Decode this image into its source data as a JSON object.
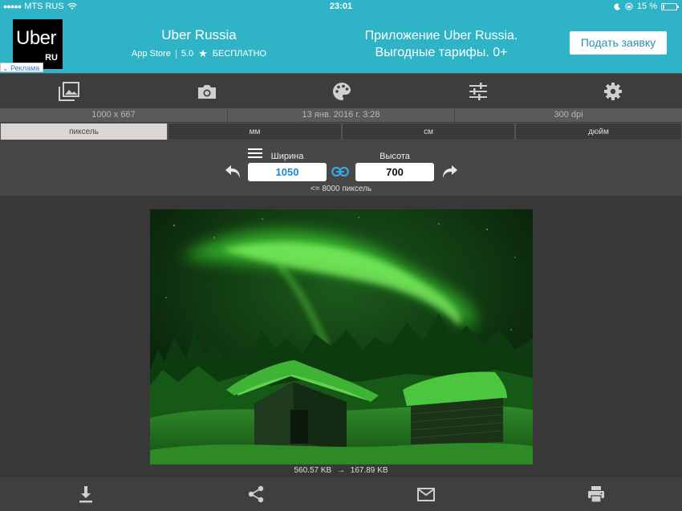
{
  "status": {
    "carrier": "MTS RUS",
    "time": "23:01",
    "battery": "15 %",
    "battery_level": 0.15
  },
  "ad": {
    "logo_text": "Uber",
    "logo_sub": "RU",
    "tag": "Реклама",
    "title": "Uber Russia",
    "store": "App Store",
    "rating": "5.0",
    "price": "БЕСПЛАТНО",
    "desc_line1": "Приложение Uber Russia.",
    "desc_line2": "Выгодные тарифы. 0+",
    "button": "Подать заявку"
  },
  "toolbar": {
    "icons": [
      "gallery-icon",
      "camera-icon",
      "palette-icon",
      "sliders-icon",
      "gear-icon"
    ]
  },
  "info": {
    "dimensions": "1000 x 667",
    "date": "13 янв. 2016 г. 3:28",
    "dpi": "300 dpi"
  },
  "units": {
    "tabs": [
      "пиксель",
      "мм",
      "см",
      "дюйм"
    ],
    "active": 0
  },
  "resize": {
    "width_label": "Ширина",
    "height_label": "Высота",
    "width_value": "1050",
    "height_value": "700",
    "limit": "<= 8000 пиксель"
  },
  "file": {
    "original_size": "560.57 KB",
    "arrow": "→",
    "new_size": "167.89 KB"
  },
  "bottom": {
    "icons": [
      "download-icon",
      "share-icon",
      "mail-icon",
      "print-icon"
    ]
  },
  "colors": {
    "accent": "#2fb4c7",
    "width_value_color": "#1e88c8",
    "aurora": "#4cff3a"
  }
}
